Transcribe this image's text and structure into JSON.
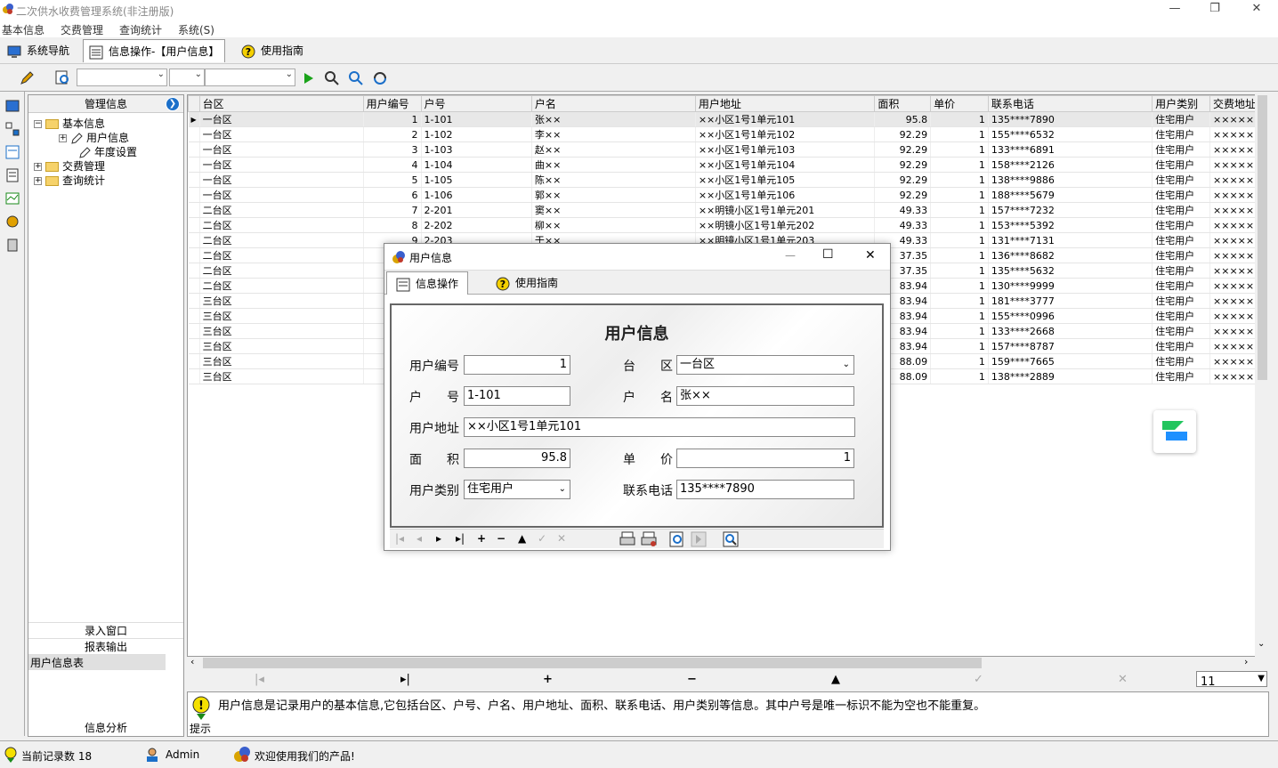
{
  "window": {
    "title": "二次供水收费管理系统(非注册版)",
    "min": "—",
    "max": "❐",
    "close": "✕"
  },
  "menu": [
    "基本信息",
    "交费管理",
    "查询统计",
    "系统(S)"
  ],
  "tabs": [
    {
      "label": "系统导航"
    },
    {
      "label": "信息操作-【用户信息】"
    },
    {
      "label": "使用指南"
    }
  ],
  "sidebar": {
    "title": "管理信息",
    "tree": [
      "基本信息",
      "用户信息",
      "年度设置",
      "交费管理",
      "查询统计"
    ],
    "bottom": [
      "录入窗口",
      "报表输出",
      "用户信息表",
      "信息分析"
    ]
  },
  "grid": {
    "columns": [
      "台区",
      "用户编号",
      "户号",
      "户名",
      "用户地址",
      "面积",
      "单价",
      "联系电话",
      "用户类别",
      "交费地址"
    ],
    "rows": [
      [
        "一台区",
        "1",
        "1-101",
        "张××",
        "××小区1号1单元101",
        "95.8",
        "1",
        "135****7890",
        "住宅用户",
        "×××××"
      ],
      [
        "一台区",
        "2",
        "1-102",
        "李××",
        "××小区1号1单元102",
        "92.29",
        "1",
        "155****6532",
        "住宅用户",
        "×××××"
      ],
      [
        "一台区",
        "3",
        "1-103",
        "赵××",
        "××小区1号1单元103",
        "92.29",
        "1",
        "133****6891",
        "住宅用户",
        "×××××"
      ],
      [
        "一台区",
        "4",
        "1-104",
        "曲××",
        "××小区1号1单元104",
        "92.29",
        "1",
        "158****2126",
        "住宅用户",
        "×××××"
      ],
      [
        "一台区",
        "5",
        "1-105",
        "陈××",
        "××小区1号1单元105",
        "92.29",
        "1",
        "138****9886",
        "住宅用户",
        "×××××"
      ],
      [
        "一台区",
        "6",
        "1-106",
        "郭××",
        "××小区1号1单元106",
        "92.29",
        "1",
        "188****5679",
        "住宅用户",
        "×××××"
      ],
      [
        "二台区",
        "7",
        "2-201",
        "窦××",
        "××明镜小区1号1单元201",
        "49.33",
        "1",
        "157****7232",
        "住宅用户",
        "×××××"
      ],
      [
        "二台区",
        "8",
        "2-202",
        "柳××",
        "××明镜小区1号1单元202",
        "49.33",
        "1",
        "153****5392",
        "住宅用户",
        "×××××"
      ],
      [
        "二台区",
        "9",
        "2-203",
        "于××",
        "××明镜小区1号1单元203",
        "49.33",
        "1",
        "131****7131",
        "住宅用户",
        "×××××"
      ],
      [
        "二台区",
        "",
        "",
        "",
        "",
        "37.35",
        "1",
        "136****8682",
        "住宅用户",
        "×××××"
      ],
      [
        "二台区",
        "",
        "",
        "",
        "",
        "37.35",
        "1",
        "135****5632",
        "住宅用户",
        "×××××"
      ],
      [
        "二台区",
        "",
        "",
        "",
        "",
        "83.94",
        "1",
        "130****9999",
        "住宅用户",
        "×××××"
      ],
      [
        "三台区",
        "",
        "",
        "",
        "",
        "83.94",
        "1",
        "181****3777",
        "住宅用户",
        "×××××"
      ],
      [
        "三台区",
        "",
        "",
        "",
        "",
        "83.94",
        "1",
        "155****0996",
        "住宅用户",
        "×××××"
      ],
      [
        "三台区",
        "",
        "",
        "",
        "",
        "83.94",
        "1",
        "133****2668",
        "住宅用户",
        "×××××"
      ],
      [
        "三台区",
        "",
        "",
        "",
        "",
        "83.94",
        "1",
        "157****8787",
        "住宅用户",
        "×××××"
      ],
      [
        "三台区",
        "",
        "",
        "",
        "",
        "88.09",
        "1",
        "159****7665",
        "住宅用户",
        "×××××"
      ],
      [
        "三台区",
        "",
        "",
        "",
        "",
        "88.09",
        "1",
        "138****2889",
        "住宅用户",
        "×××××"
      ]
    ]
  },
  "page_size": "11",
  "hint": {
    "label": "提示",
    "text": "用户信息是记录用户的基本信息,它包括台区、户号、户名、用户地址、面积、联系电话、用户类别等信息。其中户号是唯一标识不能为空也不能重复。"
  },
  "status": {
    "records": "当前记录数 18",
    "user": "Admin",
    "welcome": "欢迎使用我们的产品!"
  },
  "dialog": {
    "title": "用户信息",
    "tabs": [
      "信息操作",
      "使用指南"
    ],
    "heading": "用户信息",
    "fields": {
      "user_no_label": "用户编号",
      "user_no": "1",
      "area_label": "台　　区",
      "area": "一台区",
      "house_label": "户　　号",
      "house": "1-101",
      "name_label": "户　　名",
      "name": "张××",
      "addr_label": "用户地址",
      "addr": "××小区1号1单元101",
      "size_label": "面　　积",
      "size": "95.8",
      "price_label": "单　　价",
      "price": "1",
      "type_label": "用户类别",
      "type": "住宅用户",
      "phone_label": "联系电话",
      "phone": "135****7890"
    }
  }
}
